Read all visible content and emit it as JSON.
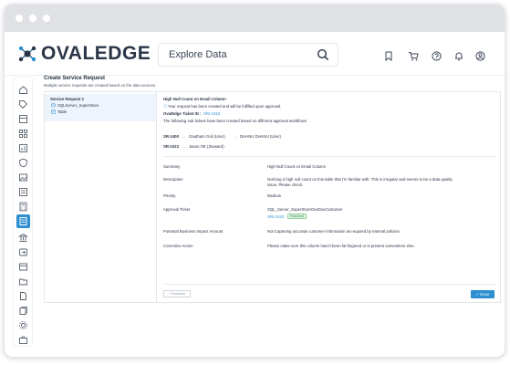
{
  "brand": {
    "name": "OVALEDGE",
    "accent": "#2d8fd0",
    "logo_icon": "molecule-logo-icon"
  },
  "search": {
    "placeholder": "Explore Data"
  },
  "toolbar_icons": [
    "bookmark-icon",
    "cart-icon",
    "help-icon",
    "bell-icon",
    "user-icon"
  ],
  "sidebar_icons": [
    "home-icon",
    "tag-icon",
    "catalog-icon",
    "grid-icon",
    "chart-icon",
    "shield-icon",
    "image-icon",
    "list-icon",
    "calculator-icon",
    "service-desk-icon",
    "governance-icon",
    "lineage-icon",
    "project-icon",
    "folder-icon",
    "document-icon",
    "files-icon",
    "settings-icon",
    "briefcase-icon"
  ],
  "page": {
    "title": "Create Service Request",
    "subtitle": "Multiple service requests are created based on the data sources."
  },
  "tree": {
    "request": "Service Request 1",
    "source": "SQLServer_SuperStore",
    "object": "Table"
  },
  "detail": {
    "heading": "High  Null Count on Email Column",
    "notice": "Your request has been created and will be fulfilled upon approval.",
    "ticket_label": "OvalEdge Ticket ID :",
    "ticket_id": "SRI-1023",
    "subtickets_note": "The following sub tickets have been created based on different approval workflows",
    "workflows": [
      {
        "id": "SR-1400",
        "steps": [
          "Gautham Goli (User)",
          "DHANU DHANU (User)"
        ]
      },
      {
        "id": "SR-1023",
        "steps": [
          "Jason OE (Steward)"
        ]
      }
    ],
    "rows": [
      {
        "label": "Summary",
        "value": "High Null Count on Email Column"
      },
      {
        "label": "Description",
        "value": "Noticing a high null count on this table that I'm familiar with. This is irregular and seems to be a data quality",
        "value2": "issue. Please check."
      },
      {
        "label": "Priority",
        "value": "Medium"
      },
      {
        "label": "Approval Ticket",
        "value": "SQL_Server_SuperStoreOneDoeCustomer",
        "ticket": "SRI-1023",
        "status": "Resolved"
      },
      {
        "label": "Potential Business Impact Amount",
        "value": "Not Capturing accurate customer information as required by internal policies"
      },
      {
        "label": "Corrective Action",
        "value": "Please make sure this column hasn't been fat fingered or is present somewhere else."
      }
    ]
  },
  "buttons": {
    "previous": "Previous",
    "done": "Done"
  }
}
